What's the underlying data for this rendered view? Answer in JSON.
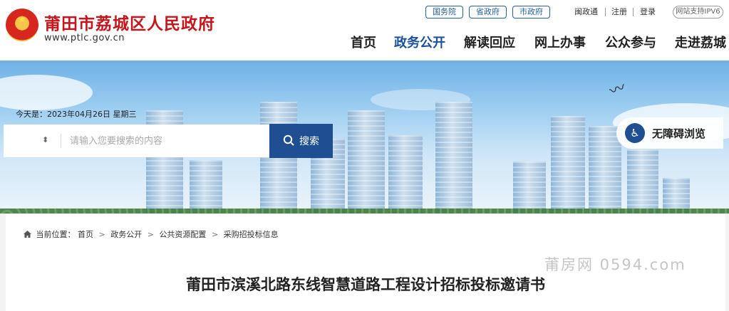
{
  "header": {
    "site_title": "莆田市荔城区人民政府",
    "site_url": "www.ptlc.gov.cn",
    "top_links": {
      "guowuyuan": "国务院",
      "shengzhengfu": "省政府",
      "shizhengfu": "市政府",
      "minzhengtong": "闽政通",
      "register": "注册",
      "login": "登录",
      "ipv6": "网站支持IPV6"
    },
    "nav": [
      {
        "label": "首页"
      },
      {
        "label": "政务公开",
        "active": true
      },
      {
        "label": "解读回应"
      },
      {
        "label": "网上办事"
      },
      {
        "label": "公众参与"
      },
      {
        "label": "走进荔城"
      }
    ]
  },
  "banner": {
    "date_text": "今天是：2023年04月26日 星期三",
    "search": {
      "select_value": "⬍",
      "placeholder": "请输入您要搜索的内容",
      "button_label": "搜索"
    },
    "accessibility_label": "无障碍浏览"
  },
  "breadcrumb": {
    "prefix": "当前位置：",
    "items": [
      "首页",
      "政务公开",
      "公共资源配置",
      "采购招投标信息"
    ],
    "separator": ">"
  },
  "watermark": "莆房网 0594.com",
  "article": {
    "title": "莆田市滨溪北路东线智慧道路工程设计招标投标邀请书"
  },
  "colors": {
    "brand_red": "#c4161c",
    "nav_active": "#1a4f9c",
    "button_blue": "#1f4f92"
  },
  "icons": [
    "national-emblem-icon",
    "search-icon",
    "accessibility-icon",
    "home-icon",
    "select-arrows-icon"
  ]
}
